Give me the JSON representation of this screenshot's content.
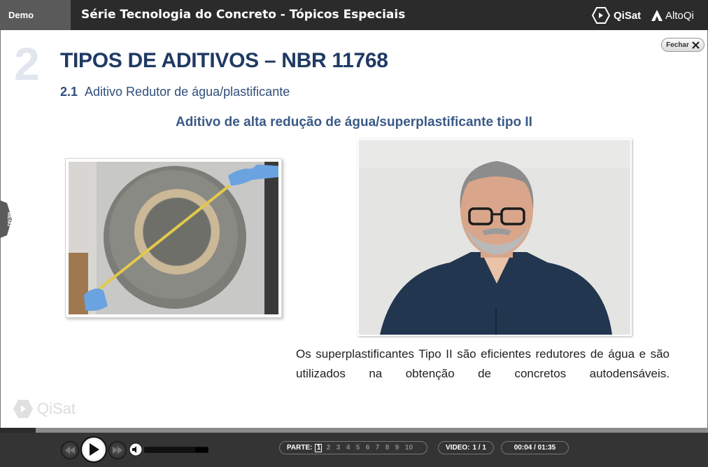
{
  "header": {
    "demo_label": "Demo",
    "course_title": "Série Tecnologia do Concreto - Tópicos Especiais",
    "brand_qisat": "QiSat",
    "brand_altoqi": "AltoQi"
  },
  "close_button": {
    "label": "Fechar"
  },
  "slide": {
    "section_number": "2",
    "section_title": "TIPOS DE ADITIVOS – NBR 11768",
    "subsection_number": "2.1",
    "subsection_title": "Aditivo Redutor de água/plastificante",
    "subtitle": "Aditivo de alta redução de água/superplastificante tipo II",
    "caption": "Os superplastificantes Tipo II são eficientes redutores de água e são utilizados na obtenção de concretos autodensáveis."
  },
  "sidebar": {
    "menu_label": "MENU"
  },
  "watermark": {
    "text": "QiSat"
  },
  "player": {
    "progress_fraction": 0.05,
    "volume_fraction": 1.0,
    "parts_label": "PARTE:",
    "parts": [
      "1",
      "2",
      "3",
      "4",
      "5",
      "6",
      "7",
      "8",
      "9",
      "10"
    ],
    "active_part": "1",
    "video_label": "VIDEO:",
    "video_value": "1 / 1",
    "time": "00:04 / 01:35"
  },
  "icons": {
    "rewind": "rewind-icon",
    "play": "play-icon",
    "fast_forward": "fast-forward-icon",
    "volume": "volume-icon",
    "close": "close-icon"
  },
  "colors": {
    "title": "#1f3a63",
    "subtitle": "#3b5a86",
    "topbar": "#2b2b2b"
  }
}
